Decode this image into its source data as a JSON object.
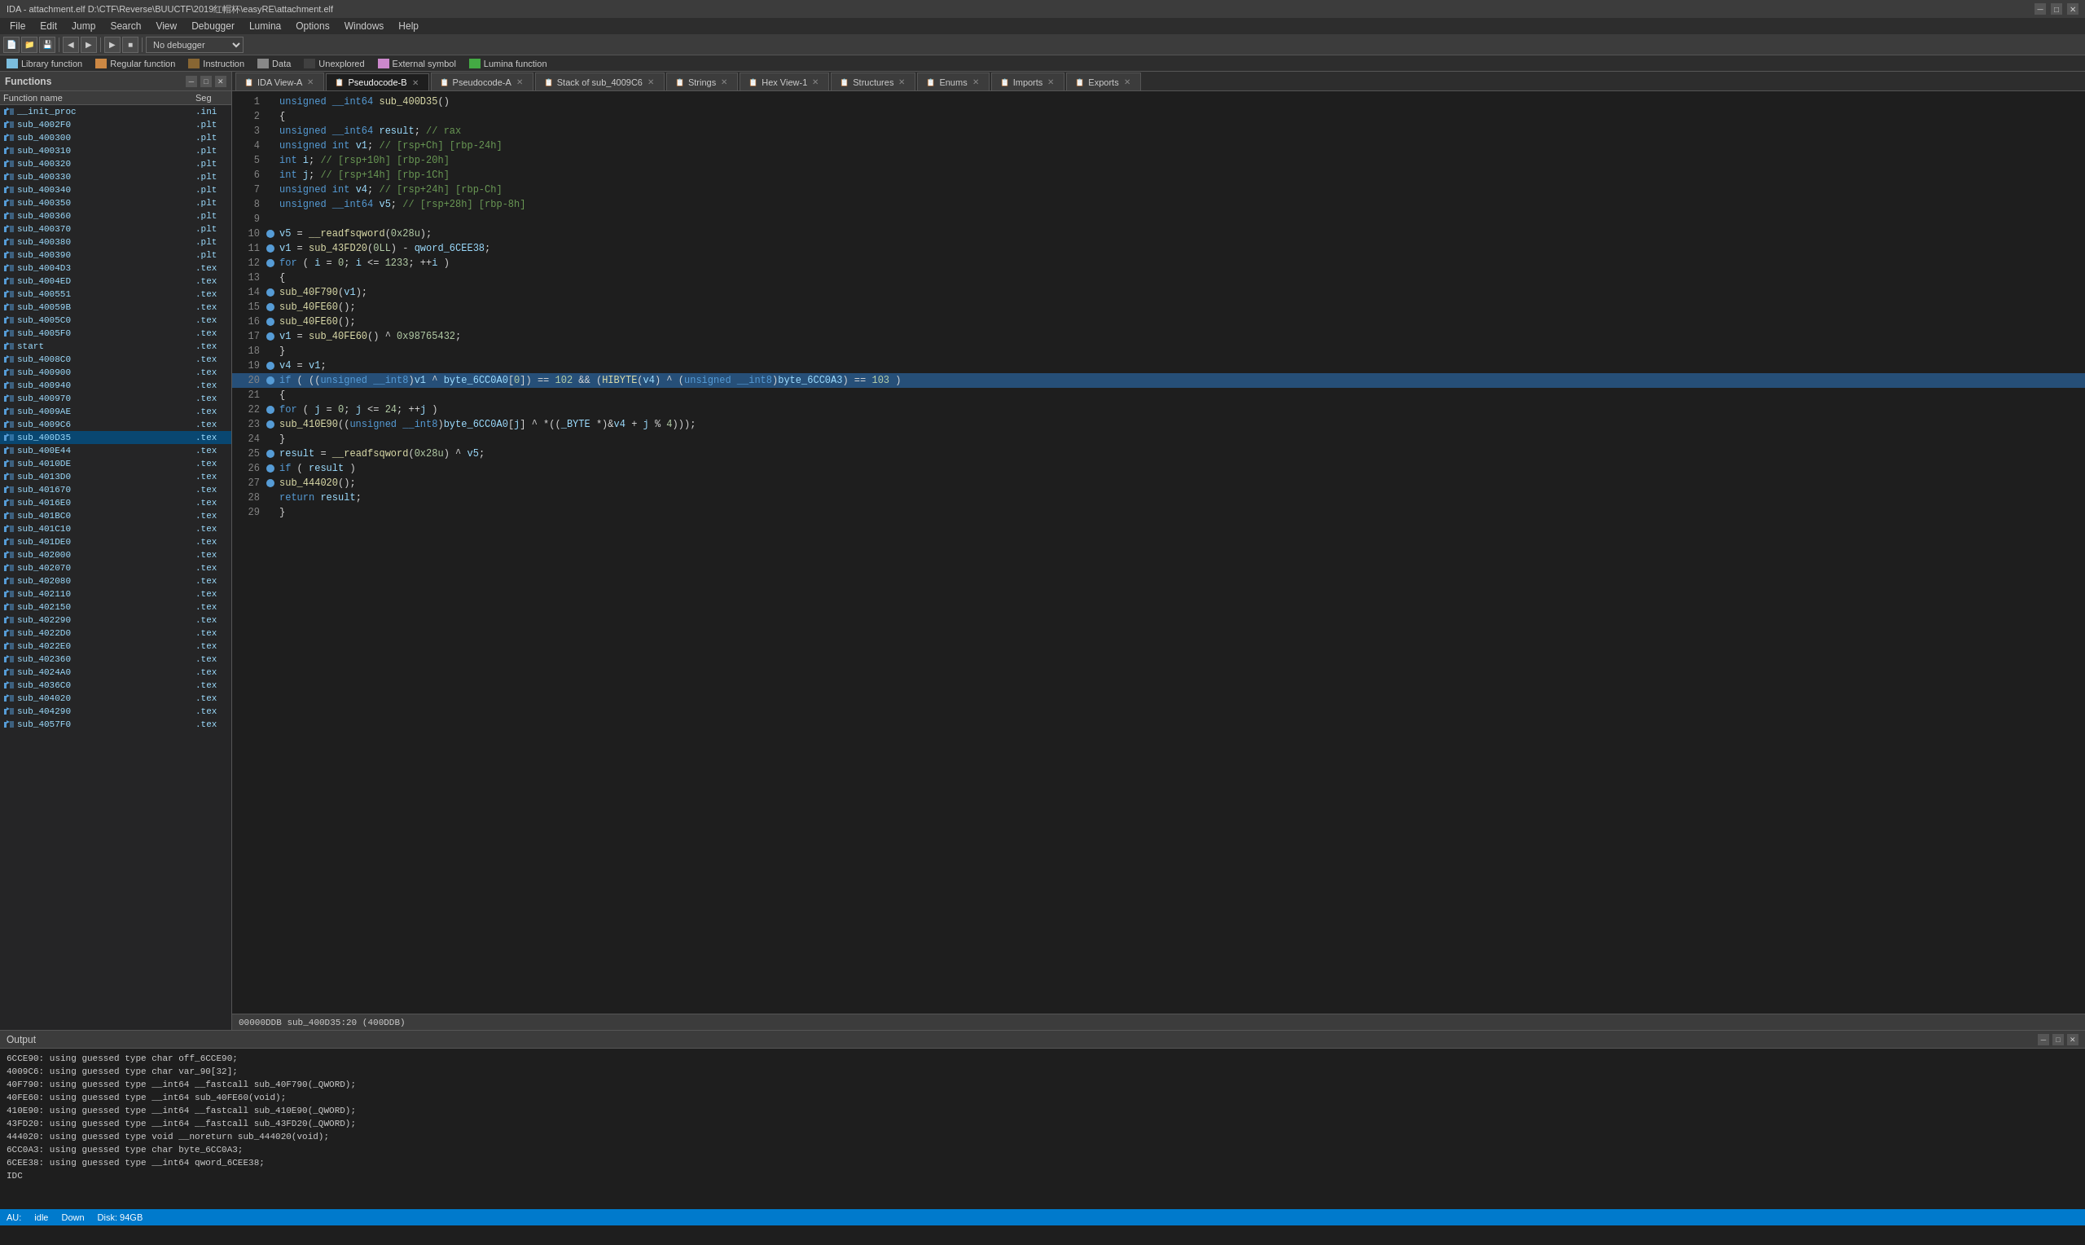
{
  "title_bar": {
    "title": "IDA - attachment.elf D:\\CTF\\Reverse\\BUUCTF\\2019红帽杯\\easyRE\\attachment.elf",
    "min_label": "─",
    "max_label": "□",
    "close_label": "✕"
  },
  "menu": {
    "items": [
      "File",
      "Edit",
      "Jump",
      "Search",
      "View",
      "Debugger",
      "Lumina",
      "Options",
      "Windows",
      "Help"
    ]
  },
  "legend": {
    "items": [
      {
        "color": "#7bbddd",
        "label": "Library function"
      },
      {
        "color": "#cc8844",
        "label": "Regular function"
      },
      {
        "color": "#886633",
        "label": "Instruction"
      },
      {
        "color": "#888888",
        "label": "Data"
      },
      {
        "color": "#404040",
        "label": "Unexplored"
      },
      {
        "color": "#cc88cc",
        "label": "External symbol"
      },
      {
        "color": "#44aa44",
        "label": "Lumina function"
      }
    ]
  },
  "functions_panel": {
    "title": "Functions",
    "col_name": "Function name",
    "col_seg": "Seg",
    "items": [
      {
        "name": "__init_proc",
        "seg": ".ini"
      },
      {
        "name": "sub_4002F0",
        "seg": ".plt"
      },
      {
        "name": "sub_400300",
        "seg": ".plt"
      },
      {
        "name": "sub_400310",
        "seg": ".plt"
      },
      {
        "name": "sub_400320",
        "seg": ".plt"
      },
      {
        "name": "sub_400330",
        "seg": ".plt"
      },
      {
        "name": "sub_400340",
        "seg": ".plt"
      },
      {
        "name": "sub_400350",
        "seg": ".plt"
      },
      {
        "name": "sub_400360",
        "seg": ".plt"
      },
      {
        "name": "sub_400370",
        "seg": ".plt"
      },
      {
        "name": "sub_400380",
        "seg": ".plt"
      },
      {
        "name": "sub_400390",
        "seg": ".plt"
      },
      {
        "name": "sub_4004D3",
        "seg": ".tex"
      },
      {
        "name": "sub_4004ED",
        "seg": ".tex"
      },
      {
        "name": "sub_400551",
        "seg": ".tex"
      },
      {
        "name": "sub_40059B",
        "seg": ".tex"
      },
      {
        "name": "sub_4005C0",
        "seg": ".tex"
      },
      {
        "name": "sub_4005F0",
        "seg": ".tex"
      },
      {
        "name": "start",
        "seg": ".tex"
      },
      {
        "name": "sub_4008C0",
        "seg": ".tex"
      },
      {
        "name": "sub_400900",
        "seg": ".tex"
      },
      {
        "name": "sub_400940",
        "seg": ".tex"
      },
      {
        "name": "sub_400970",
        "seg": ".tex"
      },
      {
        "name": "sub_4009AE",
        "seg": ".tex"
      },
      {
        "name": "sub_4009C6",
        "seg": ".tex"
      },
      {
        "name": "sub_400D35",
        "seg": ".tex"
      },
      {
        "name": "sub_400E44",
        "seg": ".tex"
      },
      {
        "name": "sub_4010DE",
        "seg": ".tex"
      },
      {
        "name": "sub_4013D0",
        "seg": ".tex"
      },
      {
        "name": "sub_401670",
        "seg": ".tex"
      },
      {
        "name": "sub_4016E0",
        "seg": ".tex"
      },
      {
        "name": "sub_401BC0",
        "seg": ".tex"
      },
      {
        "name": "sub_401C10",
        "seg": ".tex"
      },
      {
        "name": "sub_401DE0",
        "seg": ".tex"
      },
      {
        "name": "sub_402000",
        "seg": ".tex"
      },
      {
        "name": "sub_402070",
        "seg": ".tex"
      },
      {
        "name": "sub_402080",
        "seg": ".tex"
      },
      {
        "name": "sub_402110",
        "seg": ".tex"
      },
      {
        "name": "sub_402150",
        "seg": ".tex"
      },
      {
        "name": "sub_402290",
        "seg": ".tex"
      },
      {
        "name": "sub_4022D0",
        "seg": ".tex"
      },
      {
        "name": "sub_4022E0",
        "seg": ".tex"
      },
      {
        "name": "sub_402360",
        "seg": ".tex"
      },
      {
        "name": "sub_4024A0",
        "seg": ".tex"
      },
      {
        "name": "sub_4036C0",
        "seg": ".tex"
      },
      {
        "name": "sub_404020",
        "seg": ".tex"
      },
      {
        "name": "sub_404290",
        "seg": ".tex"
      },
      {
        "name": "sub_4057F0",
        "seg": ".tex"
      }
    ]
  },
  "tabs": {
    "main_tabs": [
      {
        "label": "IDA View-A",
        "active": false,
        "closable": true
      },
      {
        "label": "Pseudocode-B",
        "active": true,
        "closable": true
      },
      {
        "label": "Pseudocode-A",
        "active": false,
        "closable": true
      },
      {
        "label": "Stack of sub_4009C6",
        "active": false,
        "closable": true
      }
    ],
    "extra_tabs": [
      {
        "label": "Strings",
        "active": false,
        "closable": true
      },
      {
        "label": "Hex View-1",
        "active": false,
        "closable": true
      },
      {
        "label": "Structures",
        "active": false,
        "closable": true
      },
      {
        "label": "Enums",
        "active": false,
        "closable": true
      },
      {
        "label": "Imports",
        "active": false,
        "closable": true
      },
      {
        "label": "Exports",
        "active": false,
        "closable": true
      }
    ]
  },
  "code": {
    "lines": [
      {
        "num": 1,
        "dot": false,
        "content": "<kw>unsigned</kw> <kw>__int64</kw> <fn>sub_400D35</fn>()"
      },
      {
        "num": 2,
        "dot": false,
        "content": "{"
      },
      {
        "num": 3,
        "dot": false,
        "content": "  <kw>unsigned</kw> <kw>__int64</kw> <var>result</var>; <cmt>// rax</cmt>"
      },
      {
        "num": 4,
        "dot": false,
        "content": "  <kw>unsigned</kw> <kw>int</kw> <var>v1</var>; <cmt>// [rsp+Ch] [rbp-24h]</cmt>"
      },
      {
        "num": 5,
        "dot": false,
        "content": "  <kw>int</kw> <var>i</var>; <cmt>// [rsp+10h] [rbp-20h]</cmt>"
      },
      {
        "num": 6,
        "dot": false,
        "content": "  <kw>int</kw> <var>j</var>; <cmt>// [rsp+14h] [rbp-1Ch]</cmt>"
      },
      {
        "num": 7,
        "dot": false,
        "content": "  <kw>unsigned</kw> <kw>int</kw> <var>v4</var>; <cmt>// [rsp+24h] [rbp-Ch]</cmt>"
      },
      {
        "num": 8,
        "dot": false,
        "content": "  <kw>unsigned</kw> <kw>__int64</kw> <var>v5</var>; <cmt>// [rsp+28h] [rbp-8h]</cmt>"
      },
      {
        "num": 9,
        "dot": false,
        "content": ""
      },
      {
        "num": 10,
        "dot": true,
        "content": "  <var>v5</var> = <fn>__readfsqword</fn>(<num>0x28u</num>);"
      },
      {
        "num": 11,
        "dot": true,
        "content": "  <var>v1</var> = <fn>sub_43FD20</fn>(<num>0LL</num>) - <var>qword_6CEE38</var>;"
      },
      {
        "num": 12,
        "dot": true,
        "content": "  <kw>for</kw> ( <var>i</var> = <num>0</num>; <var>i</var> &lt;= <num>1233</num>; ++<var>i</var> )"
      },
      {
        "num": 13,
        "dot": false,
        "content": "  {"
      },
      {
        "num": 14,
        "dot": true,
        "content": "    <fn>sub_40F790</fn>(<var>v1</var>);"
      },
      {
        "num": 15,
        "dot": true,
        "content": "    <fn>sub_40FE60</fn>();"
      },
      {
        "num": 16,
        "dot": true,
        "content": "    <fn>sub_40FE60</fn>();"
      },
      {
        "num": 17,
        "dot": true,
        "content": "    <var>v1</var> = <fn>sub_40FE60</fn>() ^ <num>0x98765432</num>;"
      },
      {
        "num": 18,
        "dot": false,
        "content": "  }"
      },
      {
        "num": 19,
        "dot": true,
        "content": "  <var>v4</var> = <var>v1</var>;"
      },
      {
        "num": 20,
        "dot": true,
        "content": "  <kw>if</kw> ( ((<kw>unsigned</kw> <kw>__int8</kw>)<var>v1</var> ^ <var>byte_6CC0A0</var>[<num>0</num>]) == <num>102</num> &amp;&amp; (<fn>HIBYTE</fn>(<var>v4</var>) ^ (<kw>unsigned</kw> <kw>__int8</kw>)<var>byte_6CC0A3</var>) == <num>103</num> )",
        "highlighted": true
      },
      {
        "num": 21,
        "dot": false,
        "content": "  {"
      },
      {
        "num": 22,
        "dot": true,
        "content": "    <kw>for</kw> ( <var>j</var> = <num>0</num>; <var>j</var> &lt;= <num>24</num>; ++<var>j</var> )"
      },
      {
        "num": 23,
        "dot": true,
        "content": "      <fn>sub_410E90</fn>((<kw>unsigned</kw> <kw>__int8</kw>)<var>byte_6CC0A0</var>[<var>j</var>] ^ *((<var>_BYTE</var> *)&amp;<var>v4</var> + <var>j</var> % <num>4</num>)));"
      },
      {
        "num": 24,
        "dot": false,
        "content": "  }"
      },
      {
        "num": 25,
        "dot": true,
        "content": "  <var>result</var> = <fn>__readfsqword</fn>(<num>0x28u</num>) ^ <var>v5</var>;"
      },
      {
        "num": 26,
        "dot": true,
        "content": "  <kw>if</kw> ( <var>result</var> )"
      },
      {
        "num": 27,
        "dot": true,
        "content": "    <fn>sub_444020</fn>();"
      },
      {
        "num": 28,
        "dot": false,
        "content": "  <kw>return</kw> <var>result</var>;"
      },
      {
        "num": 29,
        "dot": false,
        "content": "}"
      }
    ]
  },
  "code_status": {
    "text": "00000DDB sub_400D35:20 (400DDB)"
  },
  "output_panel": {
    "title": "Output",
    "lines": [
      "6CCE90: using guessed type char off_6CCE90;",
      "4009C6: using guessed type char var_90[32];",
      "40F790: using guessed type __int64 __fastcall sub_40F790(_QWORD);",
      "40FE60: using guessed type __int64 sub_40FE60(void);",
      "410E90: using guessed type __int64 __fastcall sub_410E90(_QWORD);",
      "43FD20: using guessed type __int64 __fastcall sub_43FD20(_QWORD);",
      "444020: using guessed type void __noreturn sub_444020(void);",
      "6CC0A3: using guessed type char byte_6CC0A3;",
      "6CEE38: using guessed type __int64 qword_6CEE38;"
    ]
  },
  "status_bar": {
    "au": "AU:",
    "state": "idle",
    "down": "Down",
    "disk": "Disk: 94GB"
  }
}
